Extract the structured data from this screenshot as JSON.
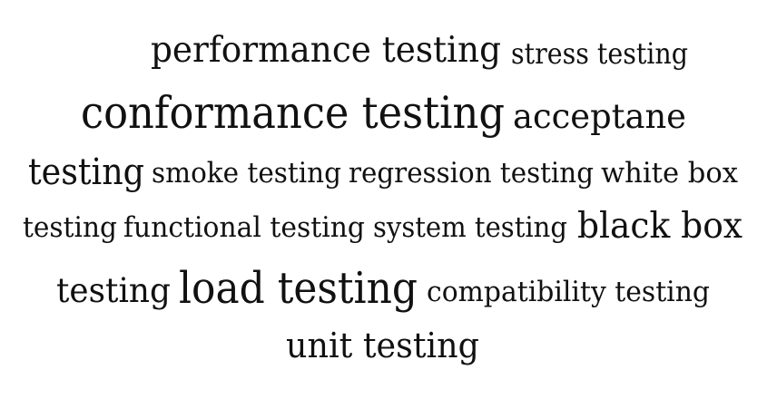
{
  "word_cloud": {
    "words": [
      {
        "text": "performance testing",
        "weight": 3
      },
      {
        "text": "stress testing",
        "weight": 1
      },
      {
        "text": "conformance testing",
        "weight": 4
      },
      {
        "text": "acceptane",
        "weight": 2
      },
      {
        "text": "testing",
        "weight": 2
      },
      {
        "text": "smoke testing",
        "weight": 1
      },
      {
        "text": "regression testing",
        "weight": 1
      },
      {
        "text": "white box",
        "weight": 1
      },
      {
        "text": "testing",
        "weight": 1
      },
      {
        "text": "functional testing",
        "weight": 1
      },
      {
        "text": "system testing",
        "weight": 1
      },
      {
        "text": "black box",
        "weight": 3
      },
      {
        "text": "testing",
        "weight": 2
      },
      {
        "text": "load testing",
        "weight": 4
      },
      {
        "text": "compatibility testing",
        "weight": 1
      },
      {
        "text": "unit testing",
        "weight": 2
      }
    ],
    "text_color": "#111111",
    "background_color": "#ffffff"
  }
}
